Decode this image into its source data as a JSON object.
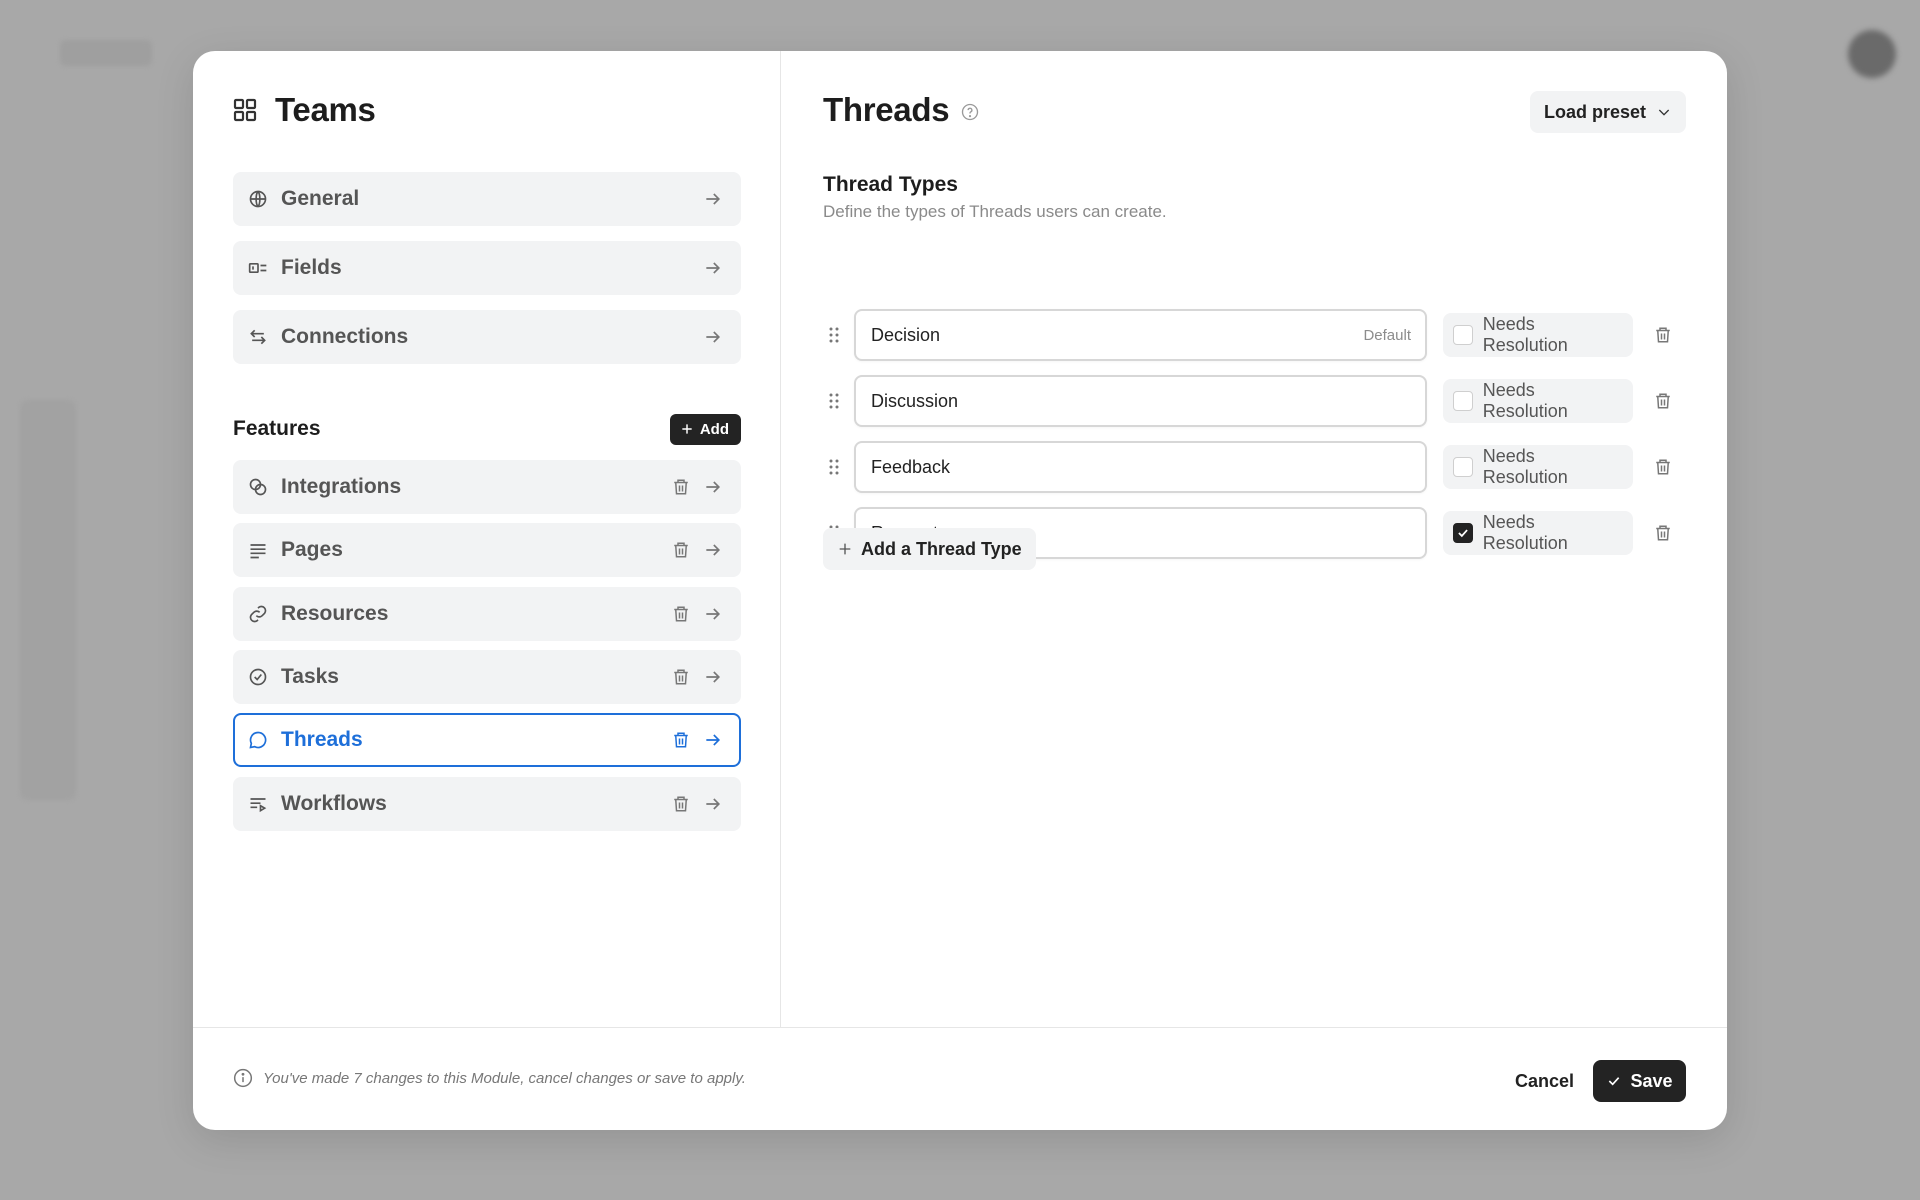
{
  "modal": {
    "left_title": "Teams",
    "settings": [
      {
        "label": "General",
        "icon": "globe-icon"
      },
      {
        "label": "Fields",
        "icon": "field-icon"
      },
      {
        "label": "Connections",
        "icon": "swap-icon"
      }
    ],
    "features_title": "Features",
    "add_label": "Add",
    "features": [
      {
        "label": "Integrations",
        "icon": "integrations-icon"
      },
      {
        "label": "Pages",
        "icon": "lines-icon"
      },
      {
        "label": "Resources",
        "icon": "link-icon"
      },
      {
        "label": "Tasks",
        "icon": "check-circle-icon"
      },
      {
        "label": "Threads",
        "icon": "chat-bubble-icon",
        "active": true
      },
      {
        "label": "Workflows",
        "icon": "workflow-icon"
      }
    ],
    "right_title": "Threads",
    "preset_label": "Load preset",
    "section_title": "Thread Types",
    "section_subtitle": "Define the types of Threads users can create.",
    "thread_types": [
      {
        "name": "Decision",
        "tag": "Default",
        "needs_resolution": false
      },
      {
        "name": "Discussion",
        "tag": "",
        "needs_resolution": false
      },
      {
        "name": "Feedback",
        "tag": "",
        "needs_resolution": false
      },
      {
        "name": "Request",
        "tag": "",
        "needs_resolution": true
      }
    ],
    "needs_resolution_label": "Needs Resolution",
    "add_type_label": "Add a Thread Type",
    "footer": {
      "notice": "You've made 7 changes to this Module, cancel changes or save to apply.",
      "cancel_label": "Cancel",
      "save_label": "Save"
    }
  },
  "colors": {
    "accent": "#1e6fd9",
    "dark": "#232323",
    "item_bg": "#f2f3f4"
  }
}
